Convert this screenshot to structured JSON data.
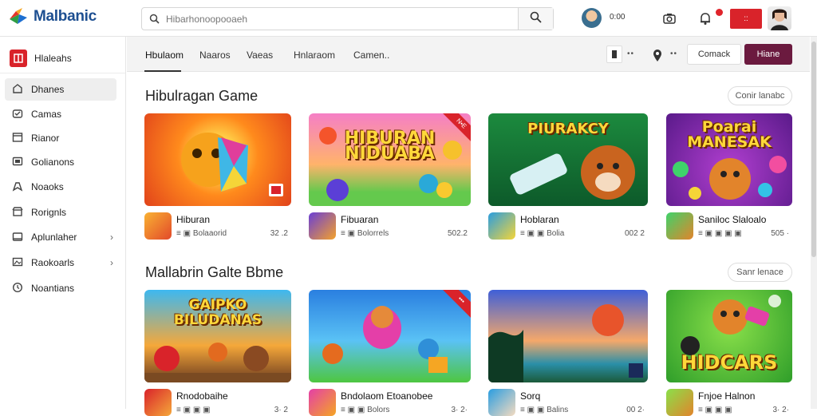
{
  "app": {
    "name": "Malbanic"
  },
  "search": {
    "placeholder": "Hibarhonoopooaeh"
  },
  "header": {
    "count": "0:00",
    "red_button": "::",
    "colors": {
      "accent": "#d9232a",
      "primary": "#6b1a3f"
    }
  },
  "sidebar": {
    "head_label": "Hlaleahs",
    "items": [
      {
        "label": "Dhanes",
        "icon": "home-icon",
        "active": true
      },
      {
        "label": "Camas",
        "icon": "gamepad-icon"
      },
      {
        "label": "Rianor",
        "icon": "calendar-icon"
      },
      {
        "label": "Golianons",
        "icon": "box-icon"
      },
      {
        "label": "Noaoks",
        "icon": "bookmark-icon"
      },
      {
        "label": "Rorignls",
        "icon": "store-icon"
      },
      {
        "label": "Aplunlaher",
        "icon": "folder-icon",
        "chevron": true
      },
      {
        "label": "Raokoarls",
        "icon": "gallery-icon",
        "chevron": true
      },
      {
        "label": "Noantians",
        "icon": "clock-icon"
      }
    ]
  },
  "tabs": [
    {
      "label": "Hbulaom",
      "active": true
    },
    {
      "label": "Naaros"
    },
    {
      "label": "Vaeas"
    },
    {
      "label": "Hnlaraom"
    },
    {
      "label": "Camen.."
    }
  ],
  "toolbar": {
    "dots": "••",
    "connect_label": "Comack",
    "primary_label": "Hiane"
  },
  "sections": [
    {
      "title": "Hibulragan Game",
      "see_all": "Conir lanabc",
      "cards": [
        {
          "thumb_text": "",
          "name": "Hiburan",
          "meta": "≡ ▣ Bolaaorid",
          "rating": "32 .2"
        },
        {
          "thumb_text": "HIBURAN NIDUABA",
          "ribbon": "N•E",
          "name": "Fibuaran",
          "meta": "≡ ▣ Bolorrels",
          "rating": "502.2"
        },
        {
          "thumb_text": "PIURAKCY",
          "name": "Hoblaran",
          "meta": "≡ ▣ ▣ Bolia",
          "rating": "002 2"
        },
        {
          "thumb_text": "Poarai MANESAK",
          "name": "Saniloc Slaloalo",
          "meta": "≡ ▣ ▣ ▣ ▣",
          "rating": "505 ·"
        }
      ]
    },
    {
      "title": "Mallabrin Galte Bbme",
      "see_all": "Sanr lenace",
      "cards": [
        {
          "thumb_text": "GAIPKO BILUDANAS",
          "name": "Rnodobaihe",
          "meta": "≡ ▣ ▣ ▣",
          "rating": "3· 2"
        },
        {
          "thumb_text": "",
          "ribbon": "•••",
          "name": "Bndolaom Etoanobee",
          "meta": "≡ ▣ ▣ Bolors",
          "rating": "3· 2·"
        },
        {
          "thumb_text": "",
          "name": "Sorq",
          "meta": "≡ ▣ ▣ Balins",
          "rating": "00 2·"
        },
        {
          "thumb_text": "HIDCARS",
          "name": "Fnjoe Halnon",
          "meta": "≡ ▣ ▣ ▣",
          "rating": "3· 2·"
        }
      ]
    }
  ]
}
